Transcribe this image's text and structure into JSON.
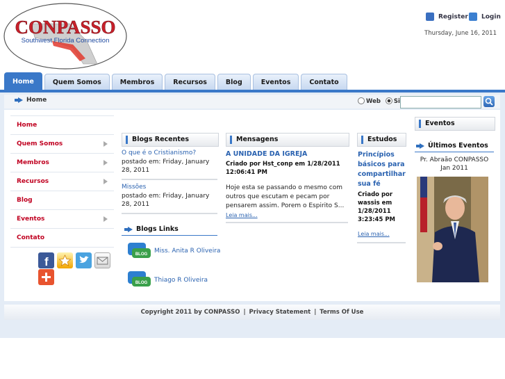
{
  "brand": {
    "name": "CONPASSO",
    "tagline": "Southwest Florida Connection"
  },
  "header": {
    "register_label": "Register",
    "login_label": "Login",
    "date": "Thursday, June 16, 2011"
  },
  "nav": {
    "tabs": [
      {
        "label": "Home",
        "active": true
      },
      {
        "label": "Quem Somos"
      },
      {
        "label": "Membros"
      },
      {
        "label": "Recursos"
      },
      {
        "label": "Blog"
      },
      {
        "label": "Eventos"
      },
      {
        "label": "Contato"
      }
    ]
  },
  "breadcrumb": {
    "label": "Home"
  },
  "search": {
    "web_label": "Web",
    "site_label": "Site",
    "selected": "Site",
    "value": ""
  },
  "left_menu": {
    "items": [
      {
        "label": "Home",
        "has_submenu": false
      },
      {
        "label": "Quem Somos",
        "has_submenu": true
      },
      {
        "label": "Membros",
        "has_submenu": true
      },
      {
        "label": "Recursos",
        "has_submenu": true
      },
      {
        "label": "Blog",
        "has_submenu": false
      },
      {
        "label": "Eventos",
        "has_submenu": true
      },
      {
        "label": "Contato",
        "has_submenu": false
      }
    ],
    "social_icons": [
      "facebook-icon",
      "favorite-star-icon",
      "twitter-icon",
      "email-icon",
      "share-plus-icon"
    ]
  },
  "blogs_recentes": {
    "title": "Blogs Recentes",
    "posts": [
      {
        "title": "O que é o Cristianismo?",
        "posted": "postado em: Friday, January 28, 2011"
      },
      {
        "title": "Missões",
        "posted": "postado em: Friday, January 28, 2011"
      }
    ]
  },
  "blogs_links": {
    "title": "Blogs Links",
    "items": [
      {
        "label": "Miss. Anita R Oliveira",
        "icon_text": "BLOG"
      },
      {
        "label": "Thiago R Oliveira",
        "icon_text": "BLOG"
      }
    ]
  },
  "mensagens": {
    "title": "Mensagens",
    "post_title": "A UNIDADE DA IGREJA",
    "meta": "Criado por Hst_conp em 1/28/2011 12:06:41 PM",
    "body": "Hoje esta se passando o mesmo com outros que escutam e pecam por pensarem assim. Porem o Espirito S...",
    "read_more": "Leia mais..."
  },
  "estudos": {
    "title": "Estudos",
    "post_title": "Princípios básicos para compartilhar sua fé",
    "meta": "Criado por wassis em 1/28/2011 3:23:45 PM",
    "read_more": "Leia mais..."
  },
  "eventos": {
    "title": "Eventos",
    "subtitle": "Últimos Eventos",
    "caption_line1": "Pr. Abraão CONPASSO",
    "caption_line2": "Jan 2011"
  },
  "footer": {
    "copyright": "Copyright 2011 by CONPASSO",
    "privacy": "Privacy Statement",
    "terms": "Terms Of Use"
  },
  "colors": {
    "accent": "#3a78c8",
    "menu_text": "#c00020",
    "link": "#2a62b0"
  }
}
